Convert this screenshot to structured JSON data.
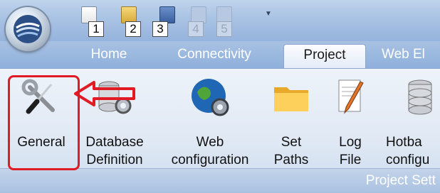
{
  "quick_access": {
    "numbers": [
      "1",
      "2",
      "3",
      "4",
      "5"
    ]
  },
  "tabs": [
    {
      "label": "Home"
    },
    {
      "label": "Connectivity"
    },
    {
      "label": "Project",
      "active": true
    },
    {
      "label": "Web El"
    }
  ],
  "commands": [
    {
      "label_lines": [
        "General"
      ],
      "icon": "wrench-screwdriver-icon"
    },
    {
      "label_lines": [
        "Database",
        "Definition"
      ],
      "icon": "database-gear-icon"
    },
    {
      "label_lines": [
        "Web",
        "configuration"
      ],
      "icon": "globe-gear-icon"
    },
    {
      "label_lines": [
        "Set",
        "Paths"
      ],
      "icon": "folder-icon"
    },
    {
      "label_lines": [
        "Log",
        "File"
      ],
      "icon": "pencil-document-icon"
    },
    {
      "label_lines": [
        "Hotba",
        "configu"
      ],
      "icon": "database-stack-icon"
    }
  ],
  "group": {
    "label": "Project Sett"
  },
  "annotation": {
    "highlight_color": "#e01b24"
  }
}
